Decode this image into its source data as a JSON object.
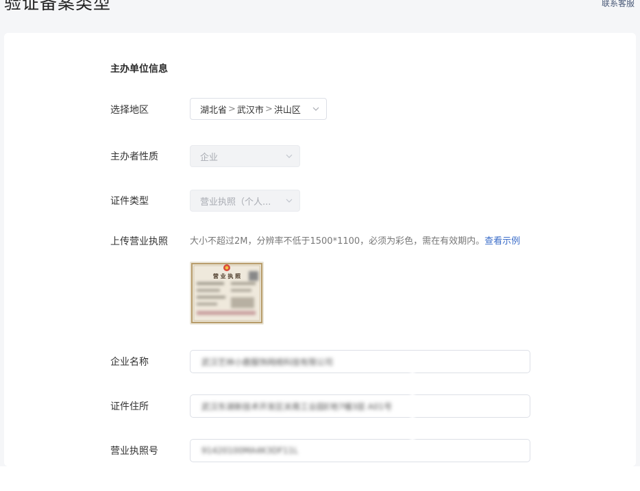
{
  "header": {
    "title": "验证备案类型",
    "contact_label": "联系客服"
  },
  "form": {
    "section_title": "主办单位信息",
    "region": {
      "label": "选择地区",
      "province": "湖北省",
      "city": "武汉市",
      "district": "洪山区",
      "separator": ">"
    },
    "organizer_nature": {
      "label": "主办者性质",
      "value": "企业"
    },
    "certificate_type": {
      "label": "证件类型",
      "value": "营业执照（个人..."
    },
    "upload": {
      "label": "上传营业执照",
      "hint": "大小不超过2M，分辨率不低于1500*1100，必须为彩色，需在有效期内。",
      "example_link": "查看示例",
      "thumbnail_text": "营 业 执 照"
    },
    "company_name": {
      "label": "企业名称",
      "value": "武汉艺林小鹿服饰网络科技有限公司"
    },
    "certificate_address": {
      "label": "证件住所",
      "value": "武汉东湖新技术开发区关南工业园E地7幢3层 A01号"
    },
    "license_number": {
      "label": "营业执照号",
      "value": "91420100MA4K3DF11L"
    }
  },
  "colors": {
    "link": "#3a6cc8",
    "background": "#f5f6f8",
    "panel": "#ffffff",
    "border": "#dcdfe6",
    "disabled_bg": "#f2f3f5"
  }
}
